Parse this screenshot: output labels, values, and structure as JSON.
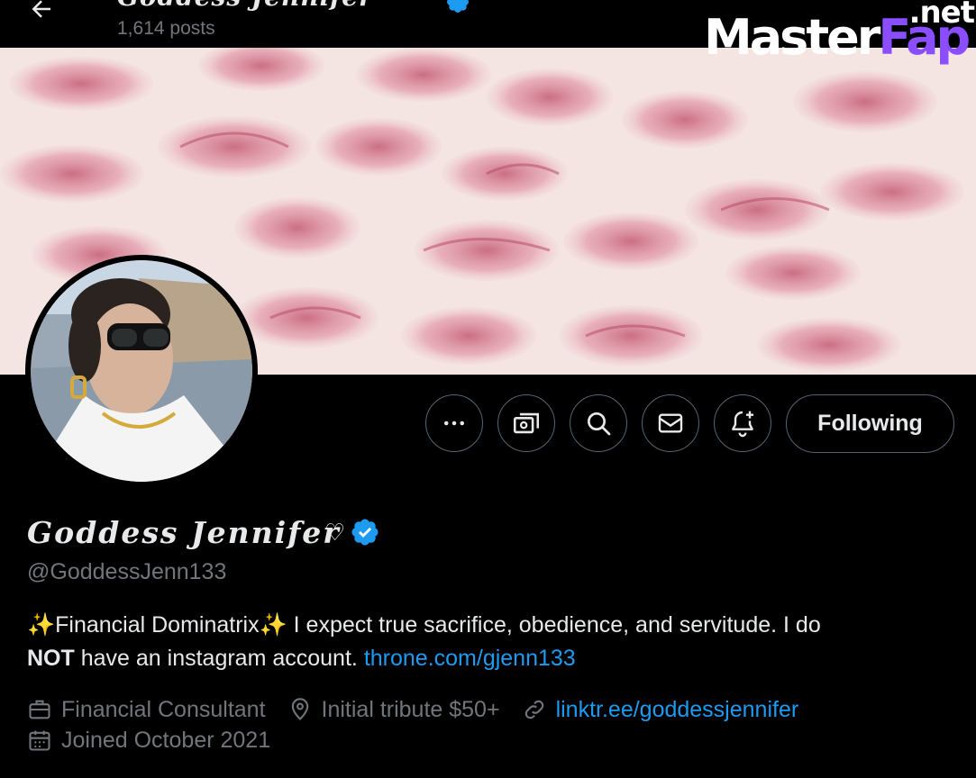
{
  "header": {
    "title": "Goddess Jennifer",
    "posts_count": "1,614 posts"
  },
  "watermark": {
    "main_a": "Master",
    "main_b": "Fap",
    "suffix": ".net"
  },
  "profile": {
    "display_name": "Goddess Jennifer",
    "name_symbol": "♡",
    "handle": "@GoddessJenn133",
    "bio": {
      "line1": "✨Financial Dominatrix✨ I expect true sacrifice, obedience, and servitude. I do",
      "not_word": "NOT",
      "line2_rest": " have an instagram account. ",
      "link": "throne.com/gjenn133"
    },
    "professional_category": "Financial Consultant",
    "location": "Initial tribute $50+",
    "website": "linktr.ee/goddessjennifer",
    "joined": "Joined October 2021"
  },
  "actions": {
    "follow_label": "Following",
    "icons": [
      "more-icon",
      "subscribe-money-icon",
      "search-icon",
      "message-icon",
      "notification-add-icon"
    ]
  },
  "colors": {
    "background": "#000000",
    "text": "#e7e9ea",
    "muted": "#71767b",
    "link": "#1d9bf0",
    "verified": "#1d9bf0",
    "border": "#536471"
  }
}
